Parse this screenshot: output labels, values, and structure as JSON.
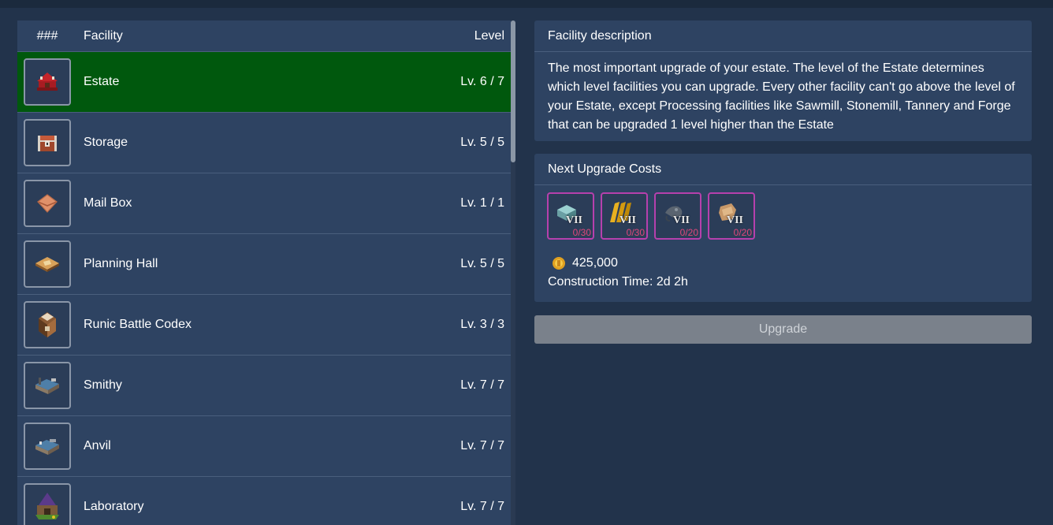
{
  "list": {
    "header": {
      "num": "###",
      "facility": "Facility",
      "level": "Level"
    },
    "rows": [
      {
        "name": "Estate",
        "level": "Lv. 6 / 7",
        "icon": "estate-icon",
        "selected": true
      },
      {
        "name": "Storage",
        "level": "Lv. 5 / 5",
        "icon": "storage-chest-icon"
      },
      {
        "name": "Mail Box",
        "level": "Lv. 1 / 1",
        "icon": "mailbox-envelope-icon"
      },
      {
        "name": "Planning Hall",
        "level": "Lv. 5 / 5",
        "icon": "planning-table-icon"
      },
      {
        "name": "Runic Battle Codex",
        "level": "Lv. 3 / 3",
        "icon": "codex-book-icon"
      },
      {
        "name": "Smithy",
        "level": "Lv. 7 / 7",
        "icon": "smithy-building-icon"
      },
      {
        "name": "Anvil",
        "level": "Lv. 7 / 7",
        "icon": "anvil-building-icon"
      },
      {
        "name": "Laboratory",
        "level": "Lv. 7 / 7",
        "icon": "laboratory-icon"
      }
    ]
  },
  "description": {
    "title": "Facility description",
    "text": "The most important upgrade of your estate. The level of the Estate determines which level facilities you can upgrade. Every other facility can't go above the level of your Estate, except Processing facilities like Sawmill, Stonemill, Tannery and Forge that can be upgraded 1 level higher than the Estate"
  },
  "costs": {
    "title": "Next Upgrade Costs",
    "items": [
      {
        "icon": "stone-block-icon",
        "tier": "VII",
        "qty": "0/30"
      },
      {
        "icon": "wood-planks-icon",
        "tier": "VII",
        "qty": "0/30"
      },
      {
        "icon": "metal-ingot-icon",
        "tier": "VII",
        "qty": "0/20"
      },
      {
        "icon": "leather-hide-icon",
        "tier": "VII",
        "qty": "0/20"
      }
    ],
    "gold": "425,000",
    "time": "Construction Time: 2d 2h"
  },
  "upgrade_label": "Upgrade",
  "colors": {
    "selected_row": "#00580d",
    "cost_border": "#b640ad",
    "qty_text": "#e0487a",
    "button_disabled": "#7a818b"
  }
}
